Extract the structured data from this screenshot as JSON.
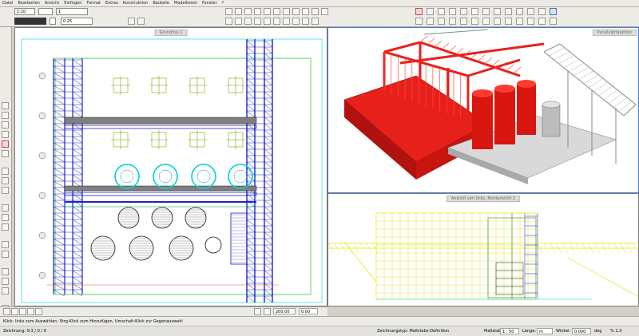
{
  "menu": [
    "Datei",
    "Bearbeiten",
    "Ansicht",
    "Einfügen",
    "Format",
    "Extras",
    "Konstruktion",
    "Bauteile",
    "Modellieren",
    "Fenster",
    "?"
  ],
  "toolbar": {
    "scale_value": "1:10",
    "line_value": "1",
    "width_value": "0.25"
  },
  "panes": {
    "top_left": {
      "title": "Grundriss 1"
    },
    "top_right": {
      "title": "Parallelprojektion"
    },
    "bottom_right": {
      "title": "Ansicht von links, Nordansicht 2"
    }
  },
  "nav": {
    "zoom_value": "200.00",
    "angle_value": "0.00"
  },
  "status": {
    "hint": "Klick: links zum Auswählen, Strg-Klick zum Hinzufügen, Umschalt-Klick zur Gegenauswahl",
    "object_info": "Zeichnung: 9.3 / 0 / 0",
    "drawing_type": "Zeichnungstyp: Maßstabs-Definition",
    "scale_label": "Maßstab:",
    "scale_value": "1 : 50",
    "length_label": "Länge:",
    "length_value": "m",
    "angle_label": "Winkel:",
    "angle_value": "0.000",
    "unit": "deg",
    "percent": "% 1.3"
  },
  "colors": {
    "plan_blue": "#1d23c4",
    "model_red": "#e8201c",
    "section_yellow": "#e8e800",
    "cyan": "#00d4d4"
  }
}
